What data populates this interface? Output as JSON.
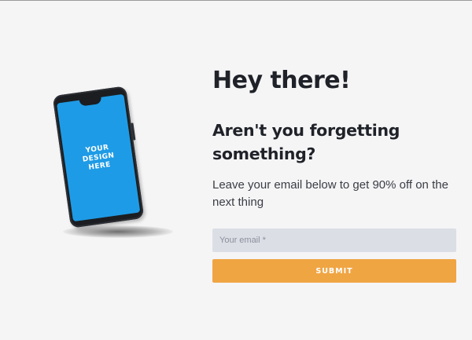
{
  "phone": {
    "screen_text": "YOUR\nDESIGN\nHERE",
    "screen_color": "#1e9be6"
  },
  "content": {
    "headline": "Hey there!",
    "subheadline": "Aren't you forgetting something?",
    "description": "Leave your email below to get 90% off on the next thing"
  },
  "form": {
    "email_placeholder": "Your email *",
    "email_value": "",
    "submit_label": "SUBMIT",
    "accent_color": "#f0a543"
  }
}
